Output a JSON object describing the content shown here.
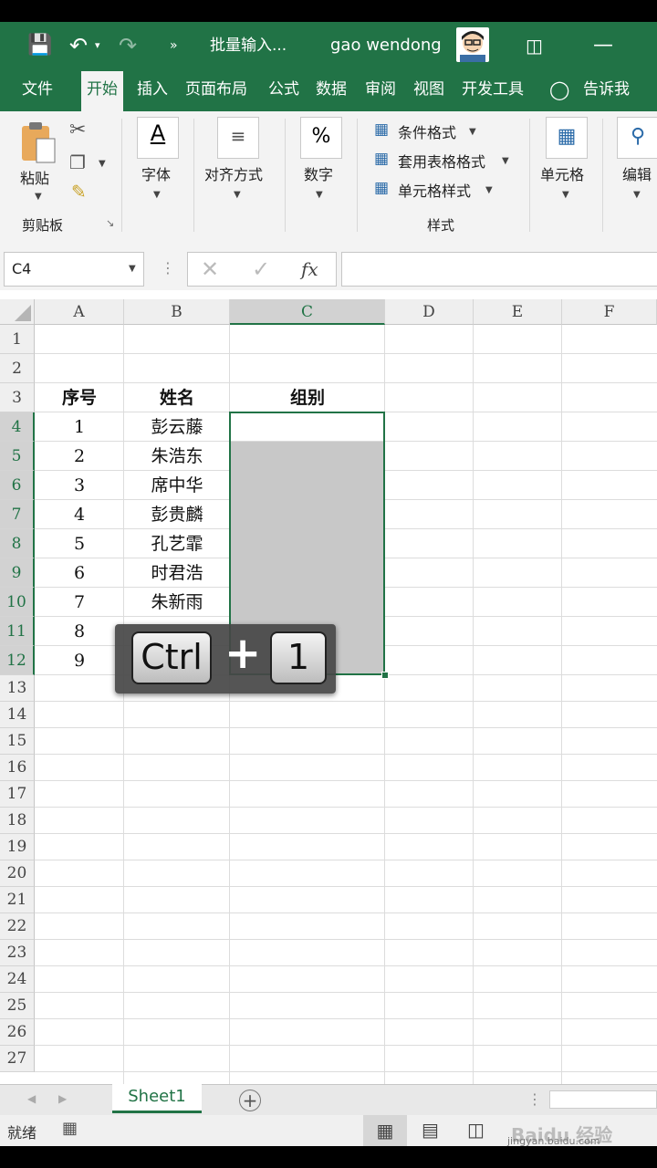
{
  "titlebar": {
    "filename": "批量输入...",
    "user": "gao wendong",
    "accent": "#217346"
  },
  "tabs": [
    "文件",
    "开始",
    "插入",
    "页面布局",
    "公式",
    "数据",
    "审阅",
    "视图",
    "开发工具",
    "告诉我"
  ],
  "active_tab": "开始",
  "ribbon": {
    "paste": "粘贴",
    "clipboard_group": "剪贴板",
    "font": "字体",
    "alignment": "对齐方式",
    "number": "数字",
    "percent_symbol": "%",
    "font_symbol": "A",
    "conditional": "条件格式",
    "table_format": "套用表格格式",
    "cell_style": "单元格样式",
    "styles_group": "样式",
    "cells": "单元格",
    "edit": "编辑"
  },
  "formula_bar": {
    "name_box": "C4",
    "fx": "fx",
    "value": ""
  },
  "columns": [
    "A",
    "B",
    "C",
    "D",
    "E",
    "F"
  ],
  "rows": [
    "1",
    "2",
    "3",
    "4",
    "5",
    "6",
    "7",
    "8",
    "9",
    "10",
    "11",
    "12",
    "13",
    "14",
    "15",
    "16",
    "17",
    "18",
    "19",
    "20",
    "21",
    "22",
    "23",
    "24",
    "25",
    "26",
    "27"
  ],
  "header_row": {
    "A": "序号",
    "B": "姓名",
    "C": "组别"
  },
  "data_rows": [
    {
      "A": "1",
      "B": "彭云藤"
    },
    {
      "A": "2",
      "B": "朱浩东"
    },
    {
      "A": "3",
      "B": "席中华"
    },
    {
      "A": "4",
      "B": "彭贵麟"
    },
    {
      "A": "5",
      "B": "孔艺霏"
    },
    {
      "A": "6",
      "B": "时君浩"
    },
    {
      "A": "7",
      "B": "朱新雨"
    },
    {
      "A": "8",
      "B": ""
    },
    {
      "A": "9",
      "B": ""
    }
  ],
  "sheet_tab": "Sheet1",
  "status": "就绪",
  "overlay": {
    "key1": "Ctrl",
    "plus": "+",
    "key2": "1"
  },
  "watermark": {
    "logo": "Baidu 经验",
    "url": "jingyan.baidu.com"
  }
}
